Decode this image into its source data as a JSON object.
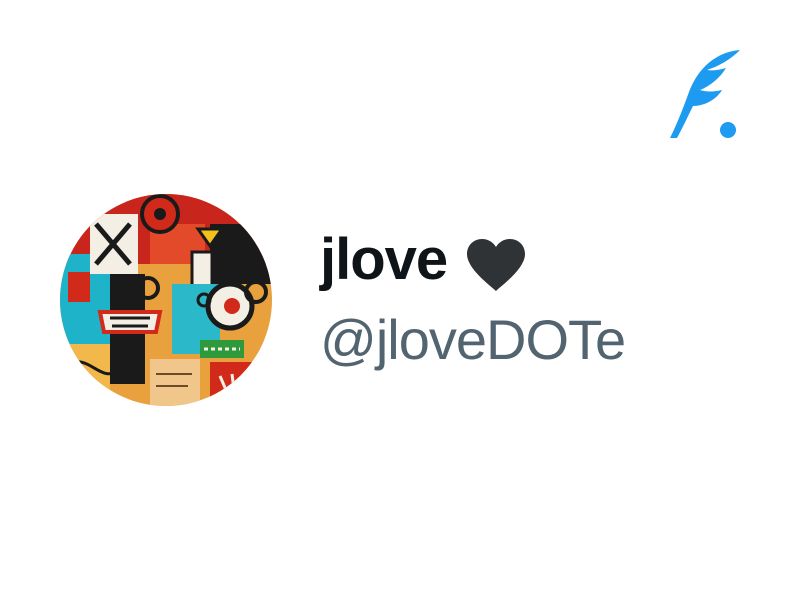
{
  "brand": {
    "icon": "feather-quill-icon",
    "color": "#1d9bf0"
  },
  "profile": {
    "avatar_icon": "abstract-art-avatar",
    "display_name": "jlove",
    "name_badge_icon": "heart-icon",
    "name_badge_color": "#2f3336",
    "handle": "@jloveDOTe"
  },
  "colors": {
    "background": "#ffffff",
    "name_text": "#0f1419",
    "handle_text": "#536471"
  }
}
